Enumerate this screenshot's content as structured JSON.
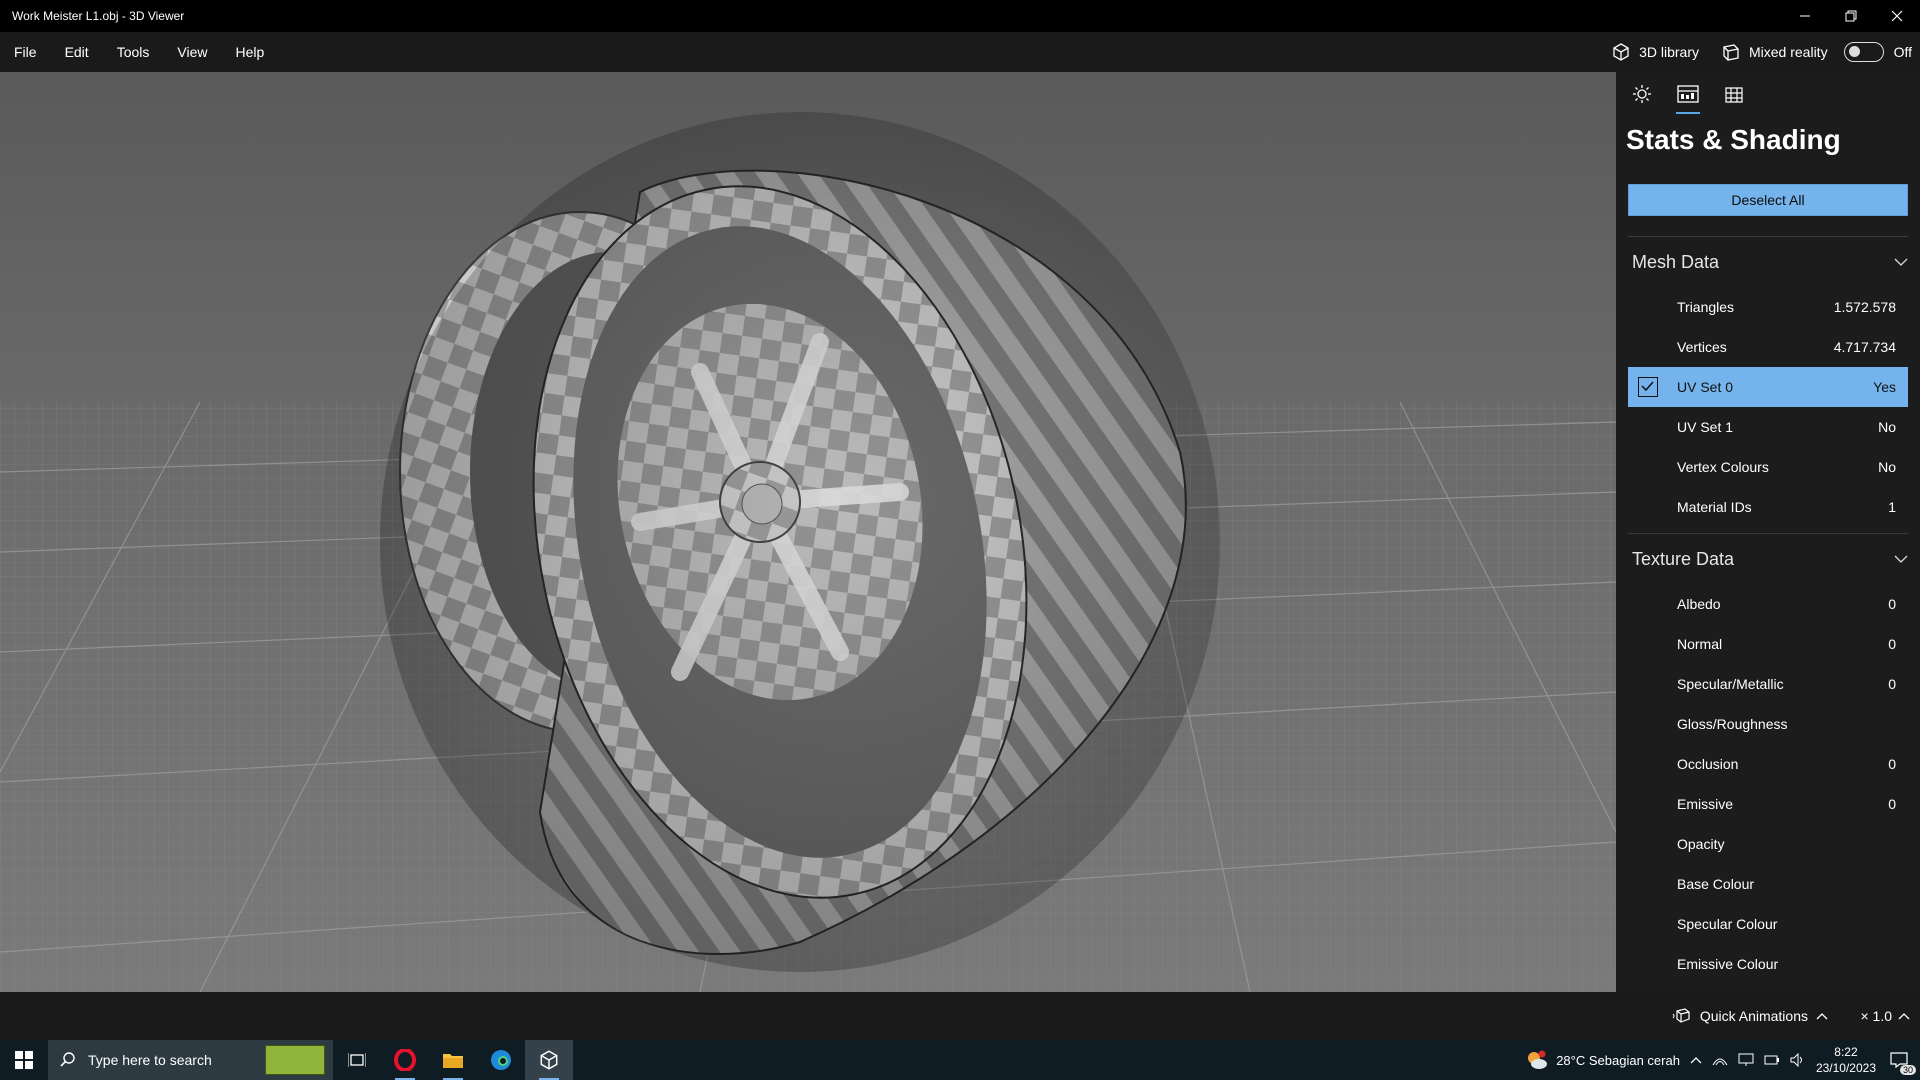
{
  "window": {
    "title": "Work Meister L1.obj - 3D Viewer",
    "minimize_icon": "minimize-icon",
    "restore_icon": "restore-icon",
    "close_icon": "close-icon"
  },
  "menu": {
    "items": [
      "File",
      "Edit",
      "Tools",
      "View",
      "Help"
    ],
    "library_label": "3D library",
    "mixed_reality_label": "Mixed reality",
    "mixed_reality_state": "Off"
  },
  "panel": {
    "tabs": [
      "lighting-icon",
      "stats-icon",
      "grid-icon"
    ],
    "title": "Stats & Shading",
    "deselect_label": "Deselect All",
    "mesh_section": "Mesh Data",
    "mesh_rows": [
      {
        "label": "Triangles",
        "value": "1.572.578"
      },
      {
        "label": "Vertices",
        "value": "4.717.734"
      },
      {
        "label": "UV Set 0",
        "value": "Yes"
      },
      {
        "label": "UV Set 1",
        "value": "No"
      },
      {
        "label": "Vertex Colours",
        "value": "No"
      },
      {
        "label": "Material IDs",
        "value": "1"
      }
    ],
    "texture_section": "Texture Data",
    "texture_rows": [
      {
        "label": "Albedo",
        "value": "0"
      },
      {
        "label": "Normal",
        "value": "0"
      },
      {
        "label": "Specular/Metallic",
        "value": "0"
      },
      {
        "label": "Gloss/Roughness",
        "value": ""
      },
      {
        "label": "Occlusion",
        "value": "0"
      },
      {
        "label": "Emissive",
        "value": "0"
      },
      {
        "label": "Opacity",
        "value": ""
      },
      {
        "label": "Base Colour",
        "value": ""
      },
      {
        "label": "Specular Colour",
        "value": ""
      },
      {
        "label": "Emissive Colour",
        "value": ""
      }
    ]
  },
  "statusbar": {
    "quick_animations": "Quick Animations",
    "zoom": "× 1.0"
  },
  "taskbar": {
    "search_placeholder": "Type here to search",
    "weather": "28°C  Sebagian cerah",
    "time": "8:22",
    "date": "23/10/2023",
    "notifications": "30"
  },
  "colors": {
    "accent": "#74b3ec",
    "panel_bg": "#1c1c1c"
  }
}
